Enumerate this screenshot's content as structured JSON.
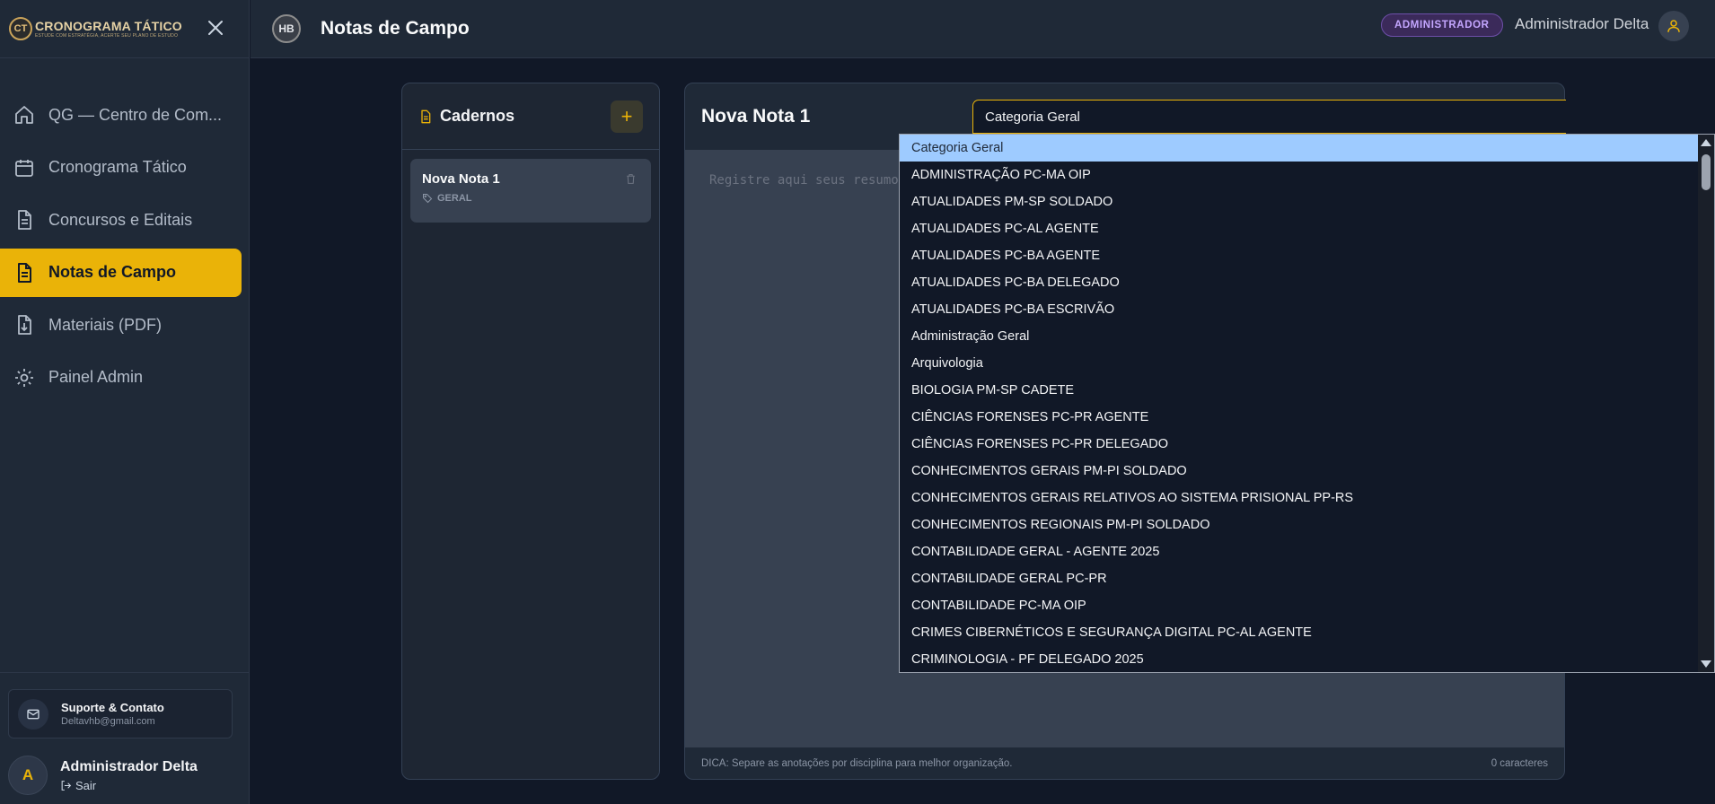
{
  "brand": {
    "logo_text": "CT",
    "title": "CRONOGRAMA TÁTICO",
    "subtitle": "ESTUDE COM ESTRATÉGIA, ACERTE SEU PLANO DE ESTUDO"
  },
  "sidebar": {
    "items": [
      {
        "label": "QG — Centro de Com...",
        "icon": "home-icon"
      },
      {
        "label": "Cronograma Tático",
        "icon": "calendar-icon"
      },
      {
        "label": "Concursos e Editais",
        "icon": "document-icon"
      },
      {
        "label": "Notas de Campo",
        "icon": "document-icon",
        "active": true
      },
      {
        "label": "Materiais (PDF)",
        "icon": "file-download-icon"
      },
      {
        "label": "Painel Admin",
        "icon": "gear-icon"
      }
    ],
    "support": {
      "title": "Suporte & Contato",
      "email": "Deltavhb@gmail.com"
    },
    "user": {
      "initial": "A",
      "name": "Administrador Delta",
      "logout": "Sair"
    }
  },
  "header": {
    "logo_text": "HB",
    "title": "Notas de Campo",
    "badge": "ADMINISTRADOR",
    "user_name": "Administrador Delta"
  },
  "notebooks": {
    "title": "Cadernos",
    "add_label": "+",
    "items": [
      {
        "title": "Nova Nota 1",
        "tag": "GERAL"
      }
    ]
  },
  "editor": {
    "title": "Nova Nota 1",
    "category_value": "Categoria Geral",
    "placeholder": "Registre aqui seus resumo",
    "tip": "DICA: Separe as anotações por disciplina para melhor organização.",
    "char_count": "0 caracteres"
  },
  "dropdown": {
    "selected": "Categoria Geral",
    "options": [
      "Categoria Geral",
      "ADMINISTRAÇÃO PC-MA OIP",
      "ATUALIDADES PM-SP SOLDADO",
      "ATUALIDADES PC-AL AGENTE",
      "ATUALIDADES PC-BA AGENTE",
      "ATUALIDADES PC-BA DELEGADO",
      "ATUALIDADES PC-BA ESCRIVÃO",
      "Administração Geral",
      "Arquivologia",
      "BIOLOGIA PM-SP CADETE",
      "CIÊNCIAS FORENSES PC-PR AGENTE",
      "CIÊNCIAS FORENSES PC-PR DELEGADO",
      "CONHECIMENTOS GERAIS PM-PI SOLDADO",
      "CONHECIMENTOS GERAIS RELATIVOS AO SISTEMA PRISIONAL PP-RS",
      "CONHECIMENTOS REGIONAIS PM-PI SOLDADO",
      "CONTABILIDADE GERAL - AGENTE 2025",
      "CONTABILIDADE GERAL PC-PR",
      "CONTABILIDADE PC-MA OIP",
      "CRIMES CIBERNÉTICOS E SEGURANÇA DIGITAL PC-AL AGENTE",
      "CRIMINOLOGIA - PF DELEGADO 2025"
    ]
  },
  "colors": {
    "accent": "#eab308",
    "background": "#111827",
    "panel": "#1f2937",
    "badge": "#c4a6ff"
  }
}
